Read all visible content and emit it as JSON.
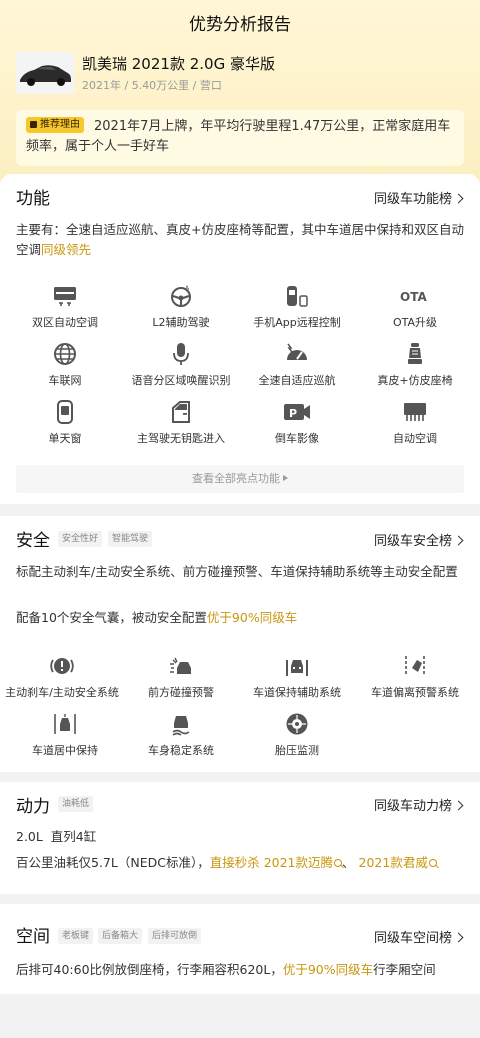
{
  "page_title": "优势分析报告",
  "car": {
    "title": "凯美瑞 2021款 2.0G 豪华版",
    "meta": "2021年 / 5.40万公里 / 营口"
  },
  "reason": {
    "tag": "推荐理由",
    "text": "2021年7月上牌，年平均行驶里程1.47万公里，正常家庭用车频率，属于个人一手好车"
  },
  "function": {
    "title": "功能",
    "link": "同级车功能榜",
    "desc_main": "主要有：全速自适应巡航、真皮+仿皮座椅等配置，其中车道居中保持和双区自动空调",
    "desc_gold": "同级领先",
    "items": [
      {
        "label": "双区自动空调",
        "icon": "dual-climate-icon"
      },
      {
        "label": "L2辅助驾驶",
        "icon": "steering-wheel-icon"
      },
      {
        "label": "手机App远程控制",
        "icon": "phone-car-icon"
      },
      {
        "label": "OTA升级",
        "icon": "ota-icon"
      },
      {
        "label": "车联网",
        "icon": "globe-icon"
      },
      {
        "label": "语音分区域唤醒识别",
        "icon": "microphone-icon"
      },
      {
        "label": "全速自适应巡航",
        "icon": "speedometer-icon"
      },
      {
        "label": "真皮+仿皮座椅",
        "icon": "seat-icon"
      },
      {
        "label": "单天窗",
        "icon": "sunroof-icon"
      },
      {
        "label": "主驾驶无钥匙进入",
        "icon": "door-key-icon"
      },
      {
        "label": "倒车影像",
        "icon": "parking-camera-icon"
      },
      {
        "label": "自动空调",
        "icon": "ac-vent-icon"
      }
    ],
    "more": "查看全部亮点功能"
  },
  "safety": {
    "title": "安全",
    "badges": [
      "安全性好",
      "智能驾驶"
    ],
    "link": "同级车安全榜",
    "desc1": "标配主动刹车/主动安全系统、前方碰撞预警、车道保持辅助系统等主动安全配置",
    "desc2_main": "配备10个安全气囊，被动安全配置",
    "desc2_gold": "优于90%同级车",
    "items": [
      {
        "label": "主动刹车/主动安全系统",
        "icon": "brake-warning-icon"
      },
      {
        "label": "前方碰撞预警",
        "icon": "collision-warning-icon"
      },
      {
        "label": "车道保持辅助系统",
        "icon": "lane-keep-icon"
      },
      {
        "label": "车道偏离预警系统",
        "icon": "lane-departure-icon"
      },
      {
        "label": "车道居中保持",
        "icon": "lane-center-icon"
      },
      {
        "label": "车身稳定系统",
        "icon": "stability-icon"
      },
      {
        "label": "胎压监测",
        "icon": "tire-pressure-icon"
      }
    ]
  },
  "power": {
    "title": "动力",
    "badges": [
      "油耗低"
    ],
    "link": "同级车动力榜",
    "engine": "2.0L  直列4缸",
    "fuel_main": "百公里油耗仅5.7L（NEDC标准），",
    "fuel_gold": "直接秒杀",
    "rival1": "2021款迈腾",
    "sep": "、",
    "rival2": "2021款君威"
  },
  "space": {
    "title": "空间",
    "badges": [
      "老板键",
      "后备箱大",
      "后排可放倒"
    ],
    "link": "同级车空间榜",
    "desc_main": "后排可40:60比例放倒座椅，行李厢容积620L，",
    "desc_gold": "优于90%同级车",
    "desc_tail": "行李厢空间"
  },
  "colors": {
    "accent": "#c9960c",
    "tag_bg": "#f7c82e",
    "hero_bg": "#fbeec0"
  }
}
